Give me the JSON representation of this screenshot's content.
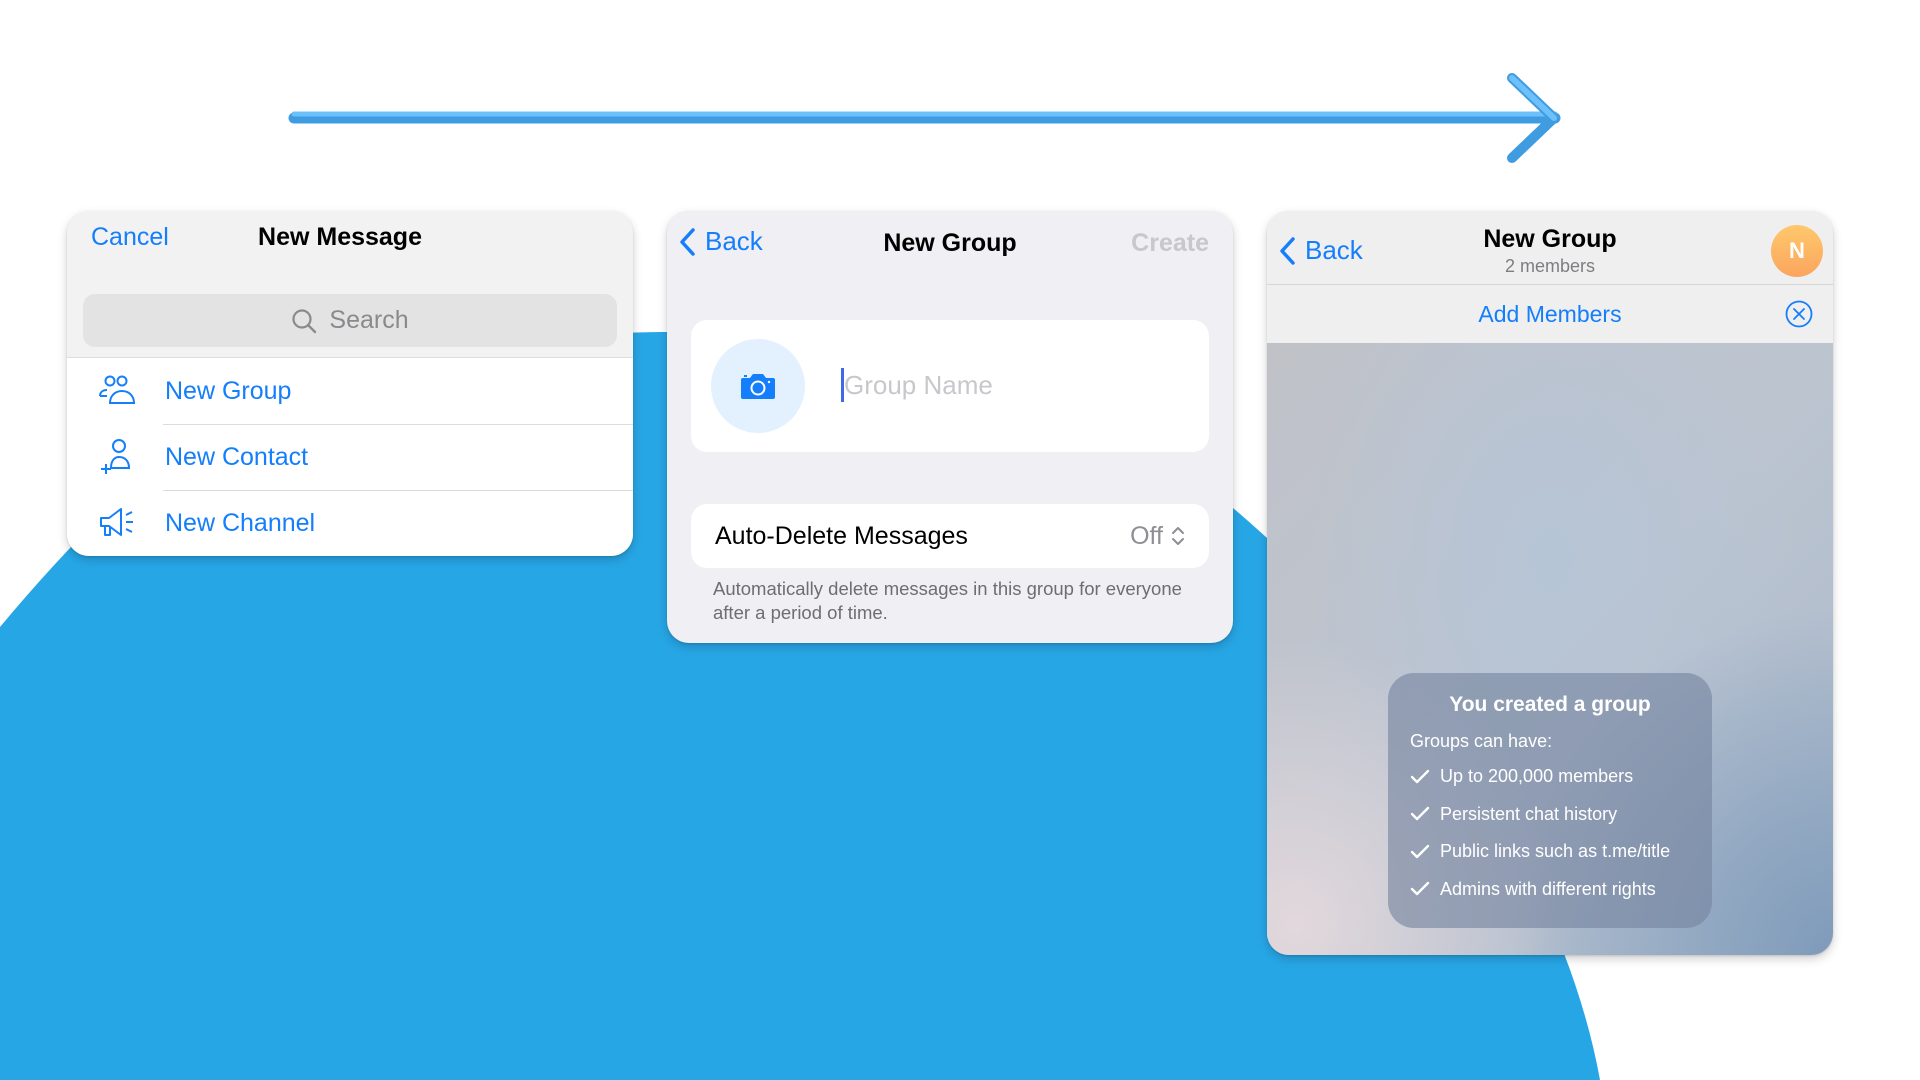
{
  "colors": {
    "accent": "#147efb",
    "background_blob": "#27a6e6",
    "arrow_light": "#6cc0fb",
    "arrow_dark": "#3f9ce0",
    "avatar": "#fbb360"
  },
  "arrow": {
    "icon": "arrow-right-icon"
  },
  "panels": {
    "new_message": {
      "cancel_label": "Cancel",
      "title": "New Message",
      "search_placeholder": "Search",
      "search_icon": "search-icon",
      "items": [
        {
          "label": "New Group",
          "icon": "group-icon"
        },
        {
          "label": "New Contact",
          "icon": "add-contact-icon"
        },
        {
          "label": "New Channel",
          "icon": "megaphone-icon"
        }
      ]
    },
    "new_group": {
      "back_label": "Back",
      "title": "New Group",
      "create_label": "Create",
      "photo_icon": "camera-icon",
      "name_placeholder": "Group Name",
      "name_value": "",
      "auto_delete_label": "Auto-Delete Messages",
      "auto_delete_value": "Off",
      "auto_delete_footnote": "Automatically delete messages in this group for everyone after a period of time."
    },
    "group_chat": {
      "back_label": "Back",
      "title": "New Group",
      "subtitle": "2 members",
      "avatar_letter": "N",
      "add_members_label": "Add Members",
      "service_message": {
        "title": "You created a group",
        "intro": "Groups can have:",
        "features": [
          "Up to 200,000 members",
          "Persistent chat history",
          "Public links such as t.me/title",
          "Admins with different rights"
        ]
      }
    }
  }
}
